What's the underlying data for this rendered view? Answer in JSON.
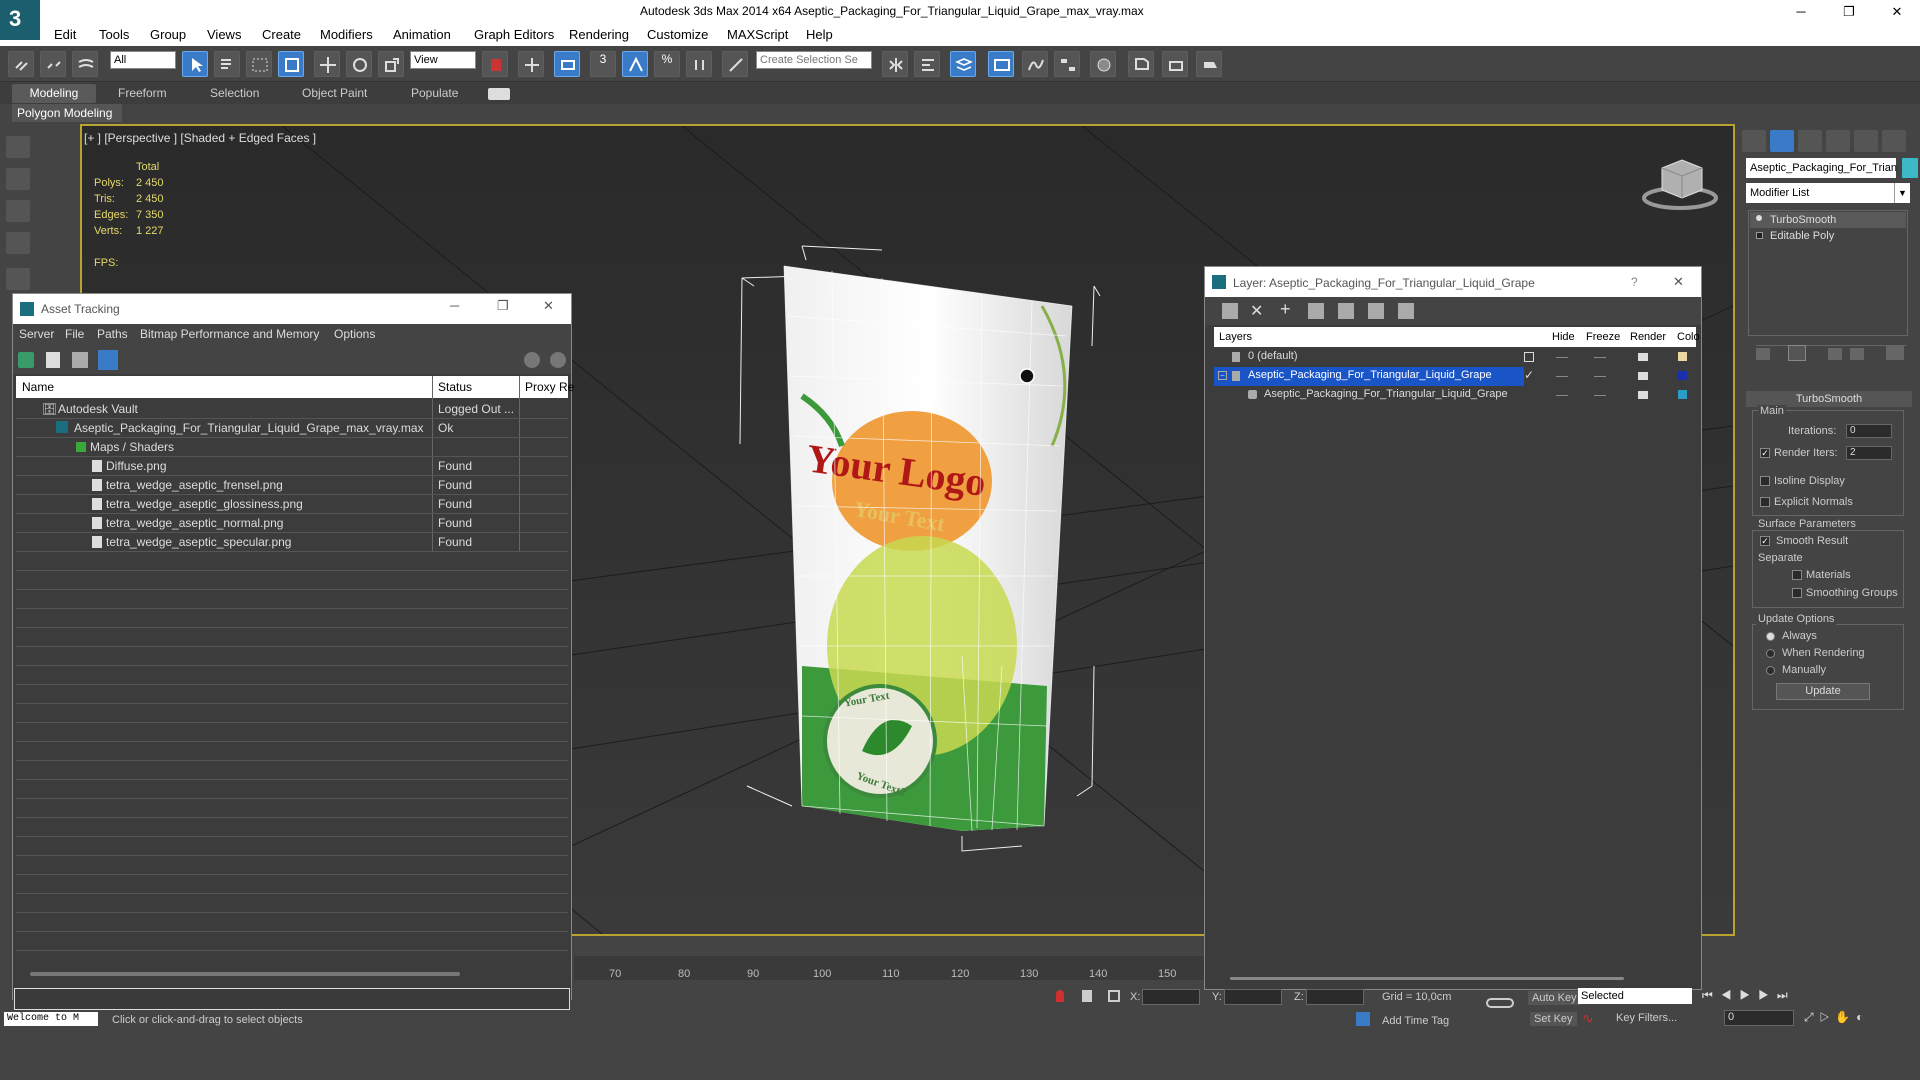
{
  "app": {
    "title": "Autodesk 3ds Max  2014 x64     Aseptic_Packaging_For_Triangular_Liquid_Grape_max_vray.max",
    "minimize": "─",
    "maximize": "❐",
    "close": "✕"
  },
  "menu": [
    "Edit",
    "Tools",
    "Group",
    "Views",
    "Create",
    "Modifiers",
    "Animation",
    "Graph Editors",
    "Rendering",
    "Customize",
    "MAXScript",
    "Help"
  ],
  "toolbar": {
    "selection_filter": "All",
    "ref_coord": "View",
    "named_selection_placeholder": "Create Selection Se",
    "snap_3": "3",
    "snap_percent": "%"
  },
  "ribbon": {
    "tabs": [
      "Modeling",
      "Freeform",
      "Selection",
      "Object Paint",
      "Populate"
    ],
    "panel_label": "Polygon Modeling"
  },
  "viewport": {
    "label": "[+ ] [Perspective ] [Shaded + Edged Faces ]",
    "stats": {
      "total_label": "Total",
      "polys_label": "Polys:",
      "polys": "2 450",
      "tris_label": "Tris:",
      "tris": "2 450",
      "edges_label": "Edges:",
      "edges": "7 350",
      "verts_label": "Verts:",
      "verts": "1 227",
      "fps_label": "FPS:"
    },
    "package": {
      "logo_text": "Your Logo",
      "sub_text": "Your Text",
      "stamp_top": "Your Text",
      "stamp_bottom": "Your Text2"
    }
  },
  "command_panel": {
    "object_name": "Aseptic_Packaging_For_Trian",
    "object_color": "#3cb8c8",
    "modifier_list": "Modifier List",
    "stack": [
      "TurboSmooth",
      "Editable Poly"
    ],
    "rollout_title": "TurboSmooth",
    "main_label": "Main",
    "iterations_label": "Iterations:",
    "iterations": "0",
    "render_iters_label": "Render Iters:",
    "render_iters": "2",
    "isoline_label": "Isoline Display",
    "explicit_label": "Explicit Normals",
    "surface_label": "Surface Parameters",
    "smooth_label": "Smooth Result",
    "separate_label": "Separate",
    "materials_label": "Materials",
    "smoothing_groups_label": "Smoothing Groups",
    "update_options_label": "Update Options",
    "always_label": "Always",
    "when_rendering_label": "When Rendering",
    "manually_label": "Manually",
    "update_button": "Update"
  },
  "asset_tracking": {
    "title": "Asset Tracking",
    "menu": [
      "Server",
      "File",
      "Paths",
      "Bitmap Performance and Memory",
      "Options"
    ],
    "columns": [
      "Name",
      "Status",
      "Proxy Re"
    ],
    "rows": [
      {
        "name": "Autodesk Vault",
        "status": "Logged Out ..."
      },
      {
        "name": "Aseptic_Packaging_For_Triangular_Liquid_Grape_max_vray.max",
        "status": "Ok"
      },
      {
        "name": "Maps / Shaders",
        "status": ""
      },
      {
        "name": "Diffuse.png",
        "status": "Found"
      },
      {
        "name": "tetra_wedge_aseptic_frensel.png",
        "status": "Found"
      },
      {
        "name": "tetra_wedge_aseptic_glossiness.png",
        "status": "Found"
      },
      {
        "name": "tetra_wedge_aseptic_normal.png",
        "status": "Found"
      },
      {
        "name": "tetra_wedge_aseptic_specular.png",
        "status": "Found"
      }
    ]
  },
  "layer_dialog": {
    "title": "Layer: Aseptic_Packaging_For_Triangular_Liquid_Grape",
    "help": "?",
    "columns": [
      "Layers",
      "Hide",
      "Freeze",
      "Render",
      "Colo"
    ],
    "rows": [
      {
        "name": "0 (default)",
        "color": "#e8d8a0"
      },
      {
        "name": "Aseptic_Packaging_For_Triangular_Liquid_Grape",
        "color": "#1a2fb0"
      },
      {
        "name": "Aseptic_Packaging_For_Triangular_Liquid_Grape",
        "color": "#2a9ec8"
      }
    ]
  },
  "timeline": {
    "ticks": [
      "70",
      "80",
      "90",
      "100",
      "110",
      "120",
      "130",
      "140",
      "150"
    ]
  },
  "status": {
    "maxscript": "Welcome to M",
    "prompt": "Click or click-and-drag to select objects",
    "x_label": "X:",
    "y_label": "Y:",
    "z_label": "Z:",
    "grid": "Grid = 10,0cm",
    "add_time_tag": "Add Time Tag",
    "auto_key": "Auto Key",
    "set_key": "Set Key",
    "key_mode": "Selected",
    "key_filters": "Key Filters...",
    "frame": "0"
  }
}
